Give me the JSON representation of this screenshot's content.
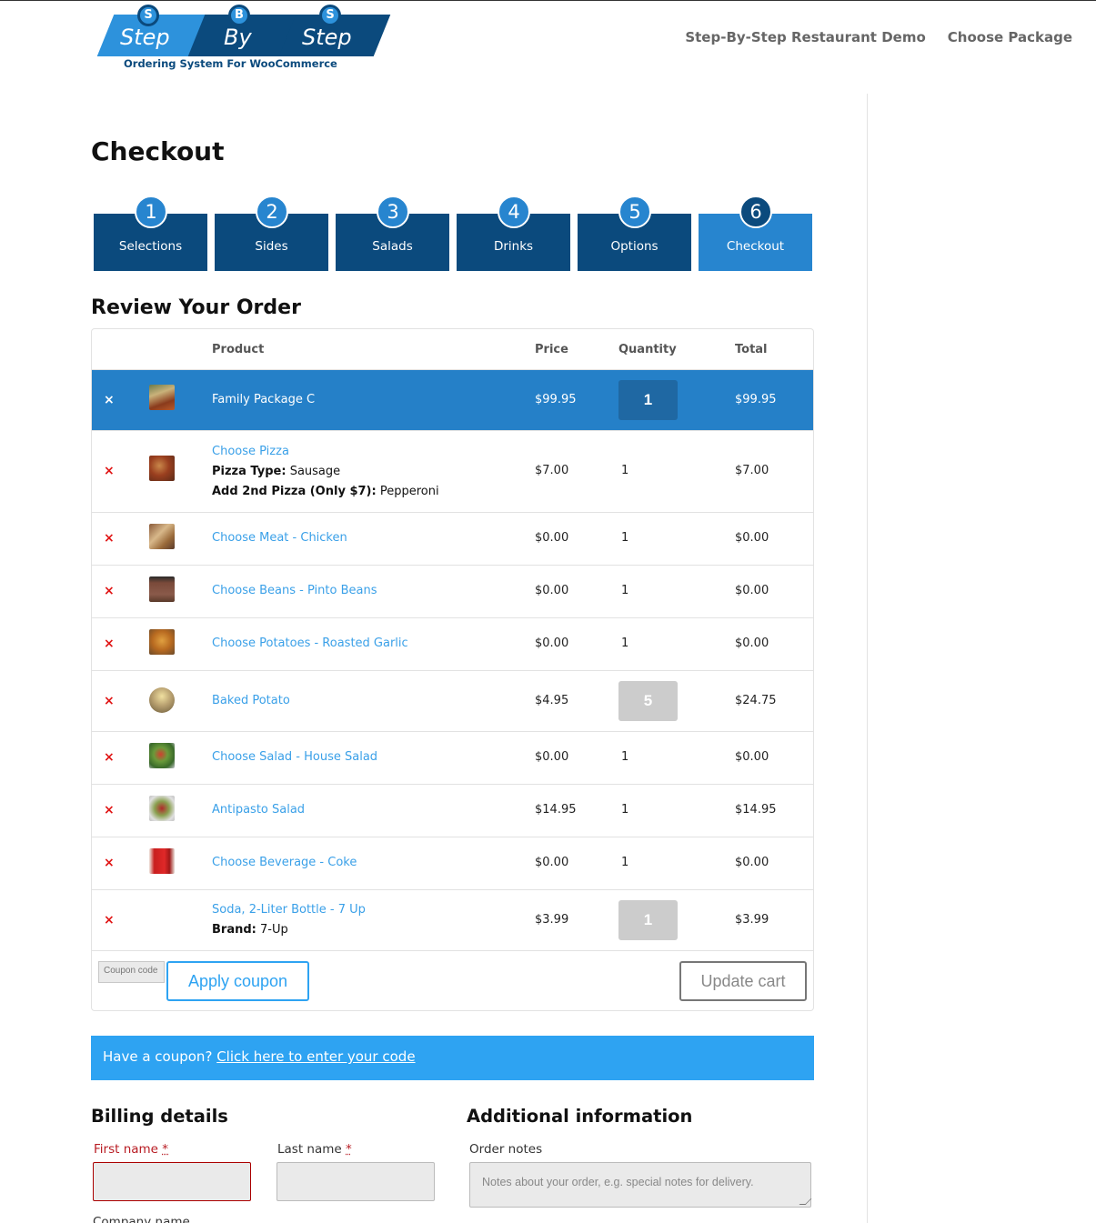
{
  "header": {
    "logo": {
      "badges": [
        "S",
        "B",
        "S"
      ],
      "words": [
        "Step",
        "By",
        "Step"
      ],
      "tagline": "Ordering System For WooCommerce"
    },
    "nav": [
      {
        "label": "Step-By-Step Restaurant Demo"
      },
      {
        "label": "Choose Package"
      }
    ]
  },
  "page_title": "Checkout",
  "steps": [
    {
      "number": "1",
      "label": "Selections",
      "active": false
    },
    {
      "number": "2",
      "label": "Sides",
      "active": false
    },
    {
      "number": "3",
      "label": "Salads",
      "active": false
    },
    {
      "number": "4",
      "label": "Drinks",
      "active": false
    },
    {
      "number": "5",
      "label": "Options",
      "active": false
    },
    {
      "number": "6",
      "label": "Checkout",
      "active": true
    }
  ],
  "review_title": "Review Your Order",
  "cart": {
    "columns": {
      "product": "Product",
      "price": "Price",
      "quantity": "Quantity",
      "total": "Total"
    },
    "rows": [
      {
        "name": "Family Package C",
        "price": "$99.95",
        "quantity": "1",
        "total": "$99.95",
        "remove_icon": "×",
        "highlight": true,
        "qty_style": "box"
      },
      {
        "name": "Choose Pizza",
        "meta": [
          {
            "key": "Pizza Type:",
            "value": "Sausage"
          },
          {
            "key": "Add 2nd Pizza (Only $7):",
            "value": "Pepperoni"
          }
        ],
        "price": "$7.00",
        "quantity": "1",
        "total": "$7.00",
        "remove_icon": "×"
      },
      {
        "name": "Choose Meat - Chicken",
        "price": "$0.00",
        "quantity": "1",
        "total": "$0.00",
        "remove_icon": "×"
      },
      {
        "name": "Choose Beans - Pinto Beans",
        "price": "$0.00",
        "quantity": "1",
        "total": "$0.00",
        "remove_icon": "×"
      },
      {
        "name": "Choose Potatoes - Roasted Garlic",
        "price": "$0.00",
        "quantity": "1",
        "total": "$0.00",
        "remove_icon": "×"
      },
      {
        "name": "Baked Potato",
        "price": "$4.95",
        "quantity": "5",
        "total": "$24.75",
        "remove_icon": "×",
        "qty_style": "input"
      },
      {
        "name": "Choose Salad - House Salad",
        "price": "$0.00",
        "quantity": "1",
        "total": "$0.00",
        "remove_icon": "×"
      },
      {
        "name": "Antipasto Salad",
        "price": "$14.95",
        "quantity": "1",
        "total": "$14.95",
        "remove_icon": "×"
      },
      {
        "name": "Choose Beverage - Coke",
        "price": "$0.00",
        "quantity": "1",
        "total": "$0.00",
        "remove_icon": "×"
      },
      {
        "name": "Soda, 2-Liter Bottle - 7 Up",
        "meta": [
          {
            "key": "Brand:",
            "value": "7-Up"
          }
        ],
        "price": "$3.99",
        "quantity": "1",
        "total": "$3.99",
        "remove_icon": "×",
        "qty_style": "input"
      }
    ],
    "coupon_placeholder": "Coupon code",
    "apply_coupon_label": "Apply coupon",
    "update_cart_label": "Update cart"
  },
  "coupon_notice": {
    "text": "Have a coupon?",
    "link": "Click here to enter your code"
  },
  "billing": {
    "title": "Billing details",
    "first_name_label": "First name",
    "last_name_label": "Last name",
    "required_mark": "*",
    "company_label": "Company name"
  },
  "additional": {
    "title": "Additional information",
    "order_notes_label": "Order notes",
    "order_notes_placeholder": "Notes about your order, e.g. special notes for delivery."
  },
  "colors": {
    "step_dark": "#0b4a7d",
    "step_active": "#2785cf",
    "link_blue": "#3aa0e8",
    "notice_blue": "#2ea3f2",
    "remove_red": "#e01515",
    "error_red": "#b81c23"
  }
}
